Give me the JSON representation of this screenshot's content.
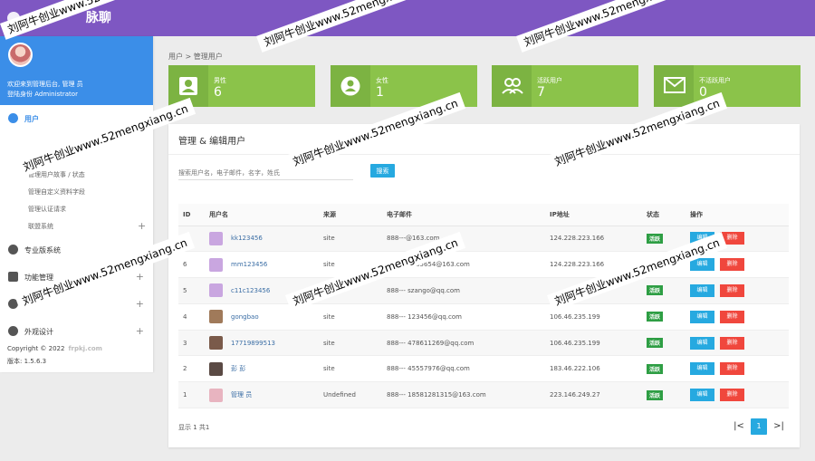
{
  "app": {
    "name_visible": "脉聊"
  },
  "profile": {
    "welcome": "欢迎来到管理后台, 管理 员",
    "role": "登陆身份 Administrator"
  },
  "sidebar": {
    "menu": [
      {
        "label": "用户",
        "sign": "−",
        "icon": "user-icon",
        "active": true
      },
      {
        "label": "专业版系统",
        "sign": "",
        "icon": "star-icon"
      },
      {
        "label": "功能管理",
        "sign": "+",
        "icon": "layers-icon"
      },
      {
        "label": "",
        "sign": "+",
        "icon": "settings-icon"
      },
      {
        "label": "外观设计",
        "sign": "+",
        "icon": "palette-icon"
      }
    ],
    "subitems": [
      "管理用户故事 / 状态",
      "管理自定义资料字段",
      "管理认证请求",
      "联盟系统"
    ],
    "sub_sign": "+"
  },
  "footer": {
    "copyright": "Copyright © 2022",
    "faint": "frpkj.com",
    "version": "版本: 1.5.6.3"
  },
  "breadcrumb": "用户 > 管理用户",
  "stats": [
    {
      "label": "男性",
      "value": "6",
      "icon": "id-card-icon"
    },
    {
      "label": "女性",
      "value": "1",
      "icon": "person-icon"
    },
    {
      "label": "活跃用户",
      "value": "7",
      "icon": "group-icon"
    },
    {
      "label": "不活跃用户",
      "value": "0",
      "icon": "mail-icon"
    }
  ],
  "panel": {
    "title": "管理 & 编辑用户",
    "search_placeholder": "搜索用户名，电子邮件，名字，姓氏",
    "search_button": "搜索"
  },
  "table": {
    "headers": [
      "ID",
      "用户名",
      "来源",
      "电子邮件",
      "IP地址",
      "状态",
      "操作"
    ],
    "rows": [
      {
        "id": "7",
        "username": "kk123456",
        "source": "site",
        "email": "888---@163.com",
        "ip": "124.228.223.166",
        "status": "活跃",
        "avatar_color": "#c9a6e0"
      },
      {
        "id": "6",
        "username": "mm123456",
        "source": "site",
        "email": "888--- 5465654@163.com",
        "ip": "124.228.223.166",
        "status": "活跃",
        "avatar_color": "#c9a6e0"
      },
      {
        "id": "5",
        "username": "c11c123456",
        "source": "",
        "email": "888--- szango@qq.com",
        "ip": "",
        "status": "活跃",
        "avatar_color": "#c9a6e0"
      },
      {
        "id": "4",
        "username": "gongbao",
        "source": "site",
        "email": "888--- 123456@qq.com",
        "ip": "106.46.235.199",
        "status": "活跃",
        "avatar_color": "#a07a5a"
      },
      {
        "id": "3",
        "username": "17719899513",
        "source": "site",
        "email": "888--- 478611269@qq.com",
        "ip": "106.46.235.199",
        "status": "活跃",
        "avatar_color": "#7a5a4a"
      },
      {
        "id": "2",
        "username": "彭 彭",
        "source": "site",
        "email": "888--- 45557976@qq.com",
        "ip": "183.46.222.106",
        "status": "活跃",
        "avatar_color": "#5a4a44"
      },
      {
        "id": "1",
        "username": "管理 员",
        "source": "Undefined",
        "email": "888--- 18581281315@163.com",
        "ip": "223.146.249.27",
        "status": "活跃",
        "avatar_color": "#e8b4c0"
      }
    ],
    "edit_label": "编辑",
    "delete_label": "删除"
  },
  "pagination": {
    "info": "显示 1 共1",
    "first": "|<",
    "current": "1",
    "last": ">|"
  },
  "watermark": "刘阿牛创业www.52mengxiang.cn",
  "colors": {
    "topbar": "#7e57c2",
    "profile": "#3b8ee8",
    "stat_green": "#8bc34a",
    "primary": "#26a9e0",
    "danger": "#f0473d",
    "active_tag": "#2e9e44"
  }
}
